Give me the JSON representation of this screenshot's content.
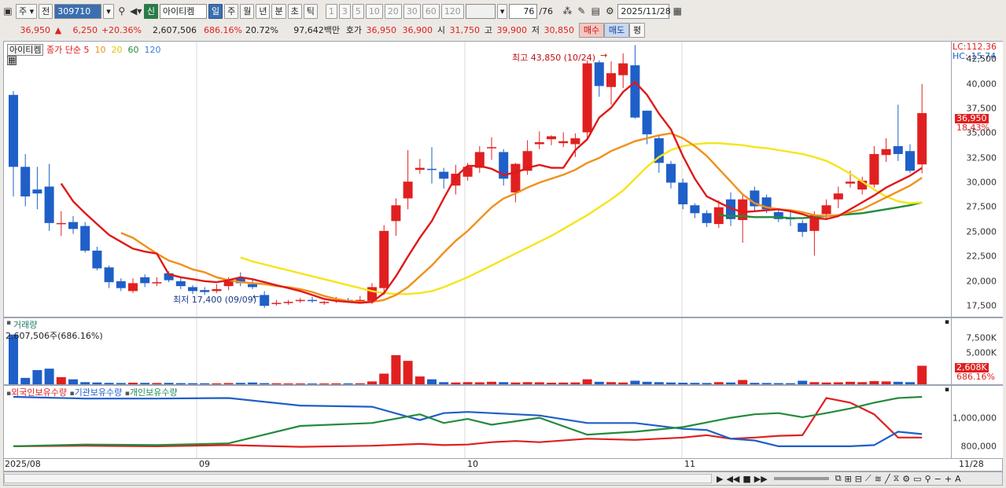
{
  "toolbar": {
    "market_label": "주",
    "prev_label": "전",
    "code_value": "309710",
    "stock_tag": "신",
    "stock_name": "아이티켐",
    "periods": [
      "일",
      "주",
      "월",
      "년",
      "분",
      "초",
      "틱"
    ],
    "numbers": [
      "1",
      "3",
      "5",
      "10",
      "20",
      "30",
      "60",
      "120"
    ],
    "count_value": "76",
    "count_total": "/76",
    "date_value": "2025/11/28"
  },
  "quote": {
    "price": "36,950",
    "change_arrow": "▲",
    "change": "6,250",
    "change_pct": "+20.36%",
    "volume": "2,607,506",
    "vol_ratio": "686.16%",
    "turnover": "20.72%",
    "amount": "97,642백만",
    "hoga_label": "호가",
    "ask": "36,950",
    "bid": "36,900",
    "open_label": "시",
    "open": "31,750",
    "high_label": "고",
    "high": "39,900",
    "low_label": "저",
    "low": "30,850",
    "buy_label": "매수",
    "sell_label": "매도",
    "avg_label": "평"
  },
  "price_panel": {
    "name": "아이티켐",
    "ma_label": "종가 단순",
    "ma_periods": [
      "5",
      "10",
      "20",
      "60",
      "120"
    ],
    "high_note": "최고 43,850 (10/24)",
    "low_note": "최저 17,400 (09/09)",
    "lc": "LC:112.36",
    "hc": "HC:-15.74",
    "ticks": [
      "42,500",
      "40,000",
      "37,500",
      "35,000",
      "32,500",
      "30,000",
      "27,500",
      "25,000",
      "22,500",
      "20,000",
      "17,500"
    ],
    "cur_price_tag": "36,950",
    "cur_pct_tag": "18.43%"
  },
  "volume_panel": {
    "title": "거래량",
    "value": "2,607,506주(686.16%)",
    "ticks": [
      "7,500K",
      "5,000K"
    ],
    "cur_tag": "2,608K",
    "cur_pct": "686.16%"
  },
  "holding_panel": {
    "series": [
      "외국인보유수량",
      "기관보유수량",
      "개인보유수량"
    ],
    "ticks": [
      "1,000,000",
      "800,000"
    ]
  },
  "xaxis": {
    "labels": [
      "2025/08",
      "09",
      "10",
      "11"
    ],
    "end_label": "11/28"
  },
  "colors": {
    "up": "#e02020",
    "down": "#1f5fc8",
    "ma5": "#e01818",
    "ma10": "#f0901a",
    "ma20": "#f5e51a",
    "ma60": "#228b3b",
    "ma120": "#3a7be0"
  },
  "chart_data": {
    "type": "candlestick",
    "candles": [
      [
        38800,
        31500,
        39200,
        28500
      ],
      [
        31500,
        28500,
        32800,
        27500
      ],
      [
        29200,
        28800,
        31500,
        27200
      ],
      [
        29500,
        25800,
        31800,
        25000
      ],
      [
        25800,
        25800,
        27000,
        24500
      ],
      [
        25900,
        25200,
        26500,
        24700
      ],
      [
        25500,
        23000,
        25900,
        22800
      ],
      [
        23000,
        21200,
        23400,
        21000
      ],
      [
        21300,
        19800,
        21500,
        19200
      ],
      [
        19900,
        19200,
        20200,
        18900
      ],
      [
        18900,
        19700,
        20200,
        18700
      ],
      [
        20300,
        19700,
        20600,
        19300
      ],
      [
        19800,
        19800,
        20300,
        19400
      ],
      [
        20700,
        20000,
        20900,
        19800
      ],
      [
        19900,
        19400,
        20300,
        19100
      ],
      [
        19300,
        18900,
        19500,
        18600
      ],
      [
        19000,
        18800,
        19300,
        18500
      ],
      [
        18900,
        19100,
        19600,
        18700
      ],
      [
        19400,
        20000,
        20300,
        19000
      ],
      [
        20200,
        19700,
        20800,
        19400
      ],
      [
        19600,
        19300,
        20000,
        19100
      ],
      [
        18500,
        17400,
        18900,
        17200
      ],
      [
        17600,
        17700,
        18000,
        17400
      ],
      [
        17700,
        17800,
        18000,
        17500
      ],
      [
        17900,
        18000,
        18200,
        17700
      ],
      [
        18000,
        17900,
        18300,
        17700
      ],
      [
        17700,
        17800,
        17900,
        17500
      ],
      [
        17900,
        18000,
        18300,
        17700
      ],
      [
        18000,
        17900,
        18200,
        17700
      ],
      [
        17900,
        18000,
        18400,
        17800
      ],
      [
        17900,
        19300,
        19700,
        17600
      ],
      [
        19200,
        25000,
        25600,
        18500
      ],
      [
        26000,
        27600,
        28300,
        24500
      ],
      [
        28300,
        30000,
        33200,
        27200
      ],
      [
        31200,
        31400,
        32300,
        30800
      ],
      [
        31300,
        31200,
        33500,
        29800
      ],
      [
        31000,
        30300,
        31400,
        29300
      ],
      [
        29600,
        30800,
        31700,
        28700
      ],
      [
        30500,
        31500,
        31900,
        30100
      ],
      [
        31400,
        33000,
        33600,
        30900
      ],
      [
        33500,
        33500,
        34500,
        32200
      ],
      [
        33000,
        30300,
        33300,
        29600
      ],
      [
        28900,
        31800,
        31900,
        27900
      ],
      [
        31100,
        33100,
        34200,
        30700
      ],
      [
        33800,
        34000,
        35100,
        33300
      ],
      [
        34300,
        34600,
        34700,
        33700
      ],
      [
        33900,
        34100,
        35000,
        33500
      ],
      [
        33800,
        34400,
        34900,
        32500
      ],
      [
        35000,
        42000,
        42300,
        34400
      ],
      [
        42100,
        39700,
        42300,
        38600
      ],
      [
        39600,
        41000,
        42200,
        37800
      ],
      [
        40800,
        42000,
        43000,
        39500
      ],
      [
        41800,
        36500,
        43850,
        36400
      ],
      [
        37200,
        34800,
        37200,
        33800
      ],
      [
        34400,
        31900,
        34800,
        30900
      ],
      [
        31800,
        29900,
        32100,
        29300
      ],
      [
        29900,
        27700,
        30300,
        27200
      ],
      [
        27600,
        26800,
        27800,
        26300
      ],
      [
        26800,
        25800,
        27100,
        25400
      ],
      [
        25700,
        27400,
        28100,
        25300
      ],
      [
        28200,
        26200,
        28900,
        25500
      ],
      [
        26100,
        28200,
        28700,
        23800
      ],
      [
        29100,
        27500,
        29500,
        26900
      ],
      [
        28400,
        27200,
        28700,
        26800
      ],
      [
        26900,
        26200,
        27300,
        25900
      ],
      [
        26300,
        26200,
        27200,
        25500
      ],
      [
        25800,
        24900,
        26100,
        24400
      ],
      [
        25000,
        26600,
        27000,
        22500
      ],
      [
        26700,
        27600,
        28200,
        26300
      ],
      [
        28200,
        28800,
        29500,
        27300
      ],
      [
        29800,
        30000,
        31100,
        29400
      ],
      [
        29200,
        30100,
        30500,
        28700
      ],
      [
        29700,
        32800,
        33600,
        29400
      ],
      [
        32700,
        33300,
        34400,
        32000
      ],
      [
        33600,
        32800,
        37800,
        32100
      ],
      [
        33100,
        31100,
        33800,
        30900
      ],
      [
        31750,
        36950,
        39900,
        30850
      ]
    ],
    "volume_k": [
      7000,
      900,
      2000,
      2200,
      1000,
      700,
      300,
      250,
      200,
      180,
      220,
      200,
      180,
      200,
      160,
      150,
      140,
      130,
      170,
      200,
      250,
      160,
      140,
      120,
      120,
      110,
      120,
      130,
      130,
      140,
      400,
      1500,
      4100,
      3300,
      1100,
      700,
      300,
      250,
      300,
      280,
      350,
      300,
      250,
      300,
      280,
      220,
      240,
      260,
      700,
      350,
      300,
      250,
      500,
      350,
      300,
      250,
      220,
      200,
      180,
      300,
      250,
      600,
      200,
      180,
      160,
      150,
      500,
      300,
      250,
      280,
      350,
      300,
      450,
      400,
      350,
      300,
      2608
    ],
    "ma5": [
      null,
      null,
      null,
      null,
      29800,
      28000,
      26800,
      25700,
      24600,
      23900,
      23200,
      22900,
      22700,
      20600,
      20300,
      20100,
      19900,
      19800,
      20000,
      20300,
      20100,
      19800,
      19500,
      19200,
      18900,
      18500,
      18100,
      17900,
      17800,
      17700,
      17800,
      18700,
      20400,
      22400,
      24300,
      26000,
      28300,
      30500,
      31600,
      31600,
      31300,
      30700,
      30900,
      31400,
      31700,
      31400,
      31400,
      33200,
      34300,
      36500,
      37500,
      39100,
      40100,
      38800,
      36900,
      35300,
      32600,
      30300,
      28500,
      27900,
      27300,
      26900,
      27000,
      27100,
      27200,
      27000,
      26700,
      26300,
      26200,
      26500,
      27200,
      27900,
      28600,
      29400,
      30000,
      30600,
      31400
    ],
    "ma10": [
      null,
      null,
      null,
      null,
      null,
      null,
      null,
      null,
      null,
      24800,
      24300,
      23500,
      22700,
      22000,
      21600,
      21100,
      20800,
      20300,
      20000,
      19800,
      19700,
      19600,
      19400,
      19300,
      19100,
      18800,
      18400,
      18100,
      17900,
      17800,
      17800,
      18000,
      18500,
      19300,
      20400,
      21500,
      22800,
      24000,
      25000,
      26200,
      27400,
      28300,
      28800,
      29400,
      29900,
      30300,
      30700,
      31200,
      31900,
      32400,
      33100,
      33600,
      34100,
      34400,
      34700,
      34900,
      34400,
      33600,
      32600,
      31300,
      30000,
      28700,
      27800,
      27400,
      27200,
      27100,
      26900,
      26600,
      26500,
      26600,
      26900,
      27200,
      27800,
      28400,
      29000,
      29600,
      30400
    ],
    "ma20": [
      null,
      null,
      null,
      null,
      null,
      null,
      null,
      null,
      null,
      null,
      null,
      null,
      null,
      null,
      null,
      null,
      null,
      null,
      null,
      22300,
      21900,
      21600,
      21300,
      21000,
      20700,
      20400,
      20100,
      19800,
      19500,
      19200,
      18900,
      18700,
      18600,
      18600,
      18700,
      18900,
      19300,
      19800,
      20300,
      20900,
      21500,
      22100,
      22700,
      23300,
      23900,
      24500,
      25200,
      25900,
      26600,
      27400,
      28200,
      29100,
      30300,
      31500,
      32500,
      33200,
      33600,
      33800,
      33900,
      33900,
      33800,
      33700,
      33500,
      33400,
      33200,
      33000,
      32800,
      32500,
      32100,
      31500,
      30800,
      30000,
      29200,
      28500,
      28000,
      27800,
      27900
    ],
    "ma60": [
      null,
      null,
      null,
      null,
      null,
      null,
      null,
      null,
      null,
      null,
      null,
      null,
      null,
      null,
      null,
      null,
      null,
      null,
      null,
      null,
      null,
      null,
      null,
      null,
      null,
      null,
      null,
      null,
      null,
      null,
      null,
      null,
      null,
      null,
      null,
      null,
      null,
      null,
      null,
      null,
      null,
      null,
      null,
      null,
      null,
      null,
      null,
      null,
      null,
      null,
      null,
      null,
      null,
      null,
      null,
      null,
      null,
      null,
      null,
      26600,
      26500,
      26500,
      26400,
      26400,
      26400,
      26300,
      26300,
      26400,
      26500,
      26600,
      26700,
      26800,
      27000,
      27200,
      27400,
      27600,
      27900
    ],
    "holding": {
      "x": [
        0,
        6,
        12,
        18,
        24,
        30,
        34,
        36,
        38,
        40,
        42,
        44,
        48,
        52,
        56,
        58,
        60,
        62,
        64,
        66,
        68,
        70,
        72,
        74,
        76
      ],
      "foreign": [
        0.15,
        0.16,
        0.15,
        0.17,
        0.14,
        0.16,
        0.19,
        0.17,
        0.18,
        0.22,
        0.24,
        0.22,
        0.28,
        0.26,
        0.3,
        0.34,
        0.28,
        0.3,
        0.33,
        0.34,
        0.98,
        0.9,
        0.7,
        0.3,
        0.3
      ],
      "institution": [
        1.0,
        0.97,
        0.97,
        0.98,
        0.85,
        0.83,
        0.6,
        0.72,
        0.74,
        0.72,
        0.7,
        0.68,
        0.55,
        0.55,
        0.45,
        0.43,
        0.28,
        0.25,
        0.15,
        0.15,
        0.15,
        0.15,
        0.17,
        0.4,
        0.36
      ],
      "individual": [
        0.15,
        0.18,
        0.17,
        0.2,
        0.5,
        0.55,
        0.7,
        0.55,
        0.62,
        0.52,
        0.58,
        0.64,
        0.35,
        0.4,
        0.48,
        0.56,
        0.64,
        0.7,
        0.72,
        0.65,
        0.72,
        0.8,
        0.9,
        0.98,
        1.0
      ]
    }
  }
}
